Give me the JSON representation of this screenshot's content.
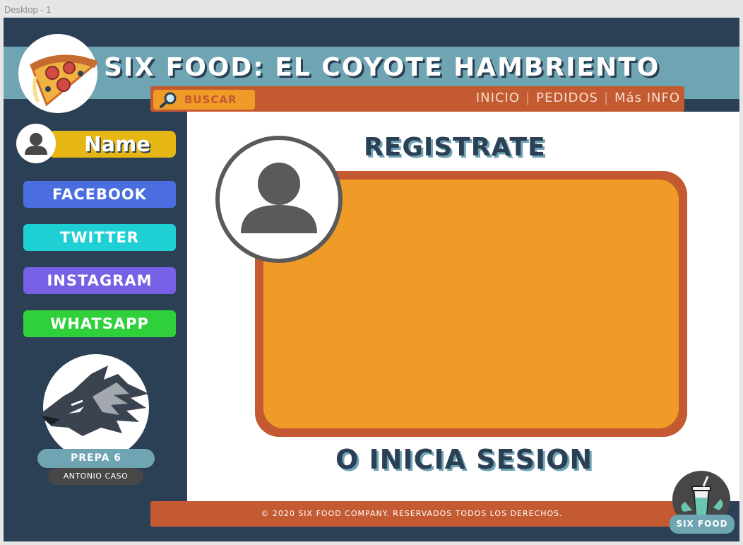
{
  "canvas": {
    "label": "Desktop - 1"
  },
  "header": {
    "title": "SIX FOOD: EL COYOTE HAMBRIENTO",
    "logo_icon": "pizza-icon",
    "search_label": "BUSCAR",
    "search_icon": "magnifier-icon",
    "nav": [
      "INICIO",
      "PEDIDOS",
      "Más INFO"
    ]
  },
  "sidebar": {
    "user_name": "Name",
    "user_icon": "user-icon",
    "social": [
      {
        "label": "FACEBOOK",
        "color": "#4a6ee0"
      },
      {
        "label": "TWITTER",
        "color": "#1ecfd4"
      },
      {
        "label": "INSTAGRAM",
        "color": "#7660e6"
      },
      {
        "label": "WHATSAPP",
        "color": "#2fd03a"
      }
    ],
    "school_logo_icon": "wolf-icon",
    "school_name": "PREPA 6",
    "school_sub": "ANTONIO CASO"
  },
  "main": {
    "register_title": "REGISTRATE",
    "avatar_icon": "user-icon",
    "login_text": "O INICIA SESION"
  },
  "footer": {
    "copyright": "© 2020 SIX FOOD COMPANY. RESERVADOS TODOS LOS DERECHOS.",
    "brand_icon": "drink-icon",
    "brand_label": "SIX FOOD"
  },
  "colors": {
    "navy": "#2b3f55",
    "teal": "#6fa4b2",
    "rust": "#c45a32",
    "orange": "#f09b28",
    "yellow": "#e6b614"
  }
}
